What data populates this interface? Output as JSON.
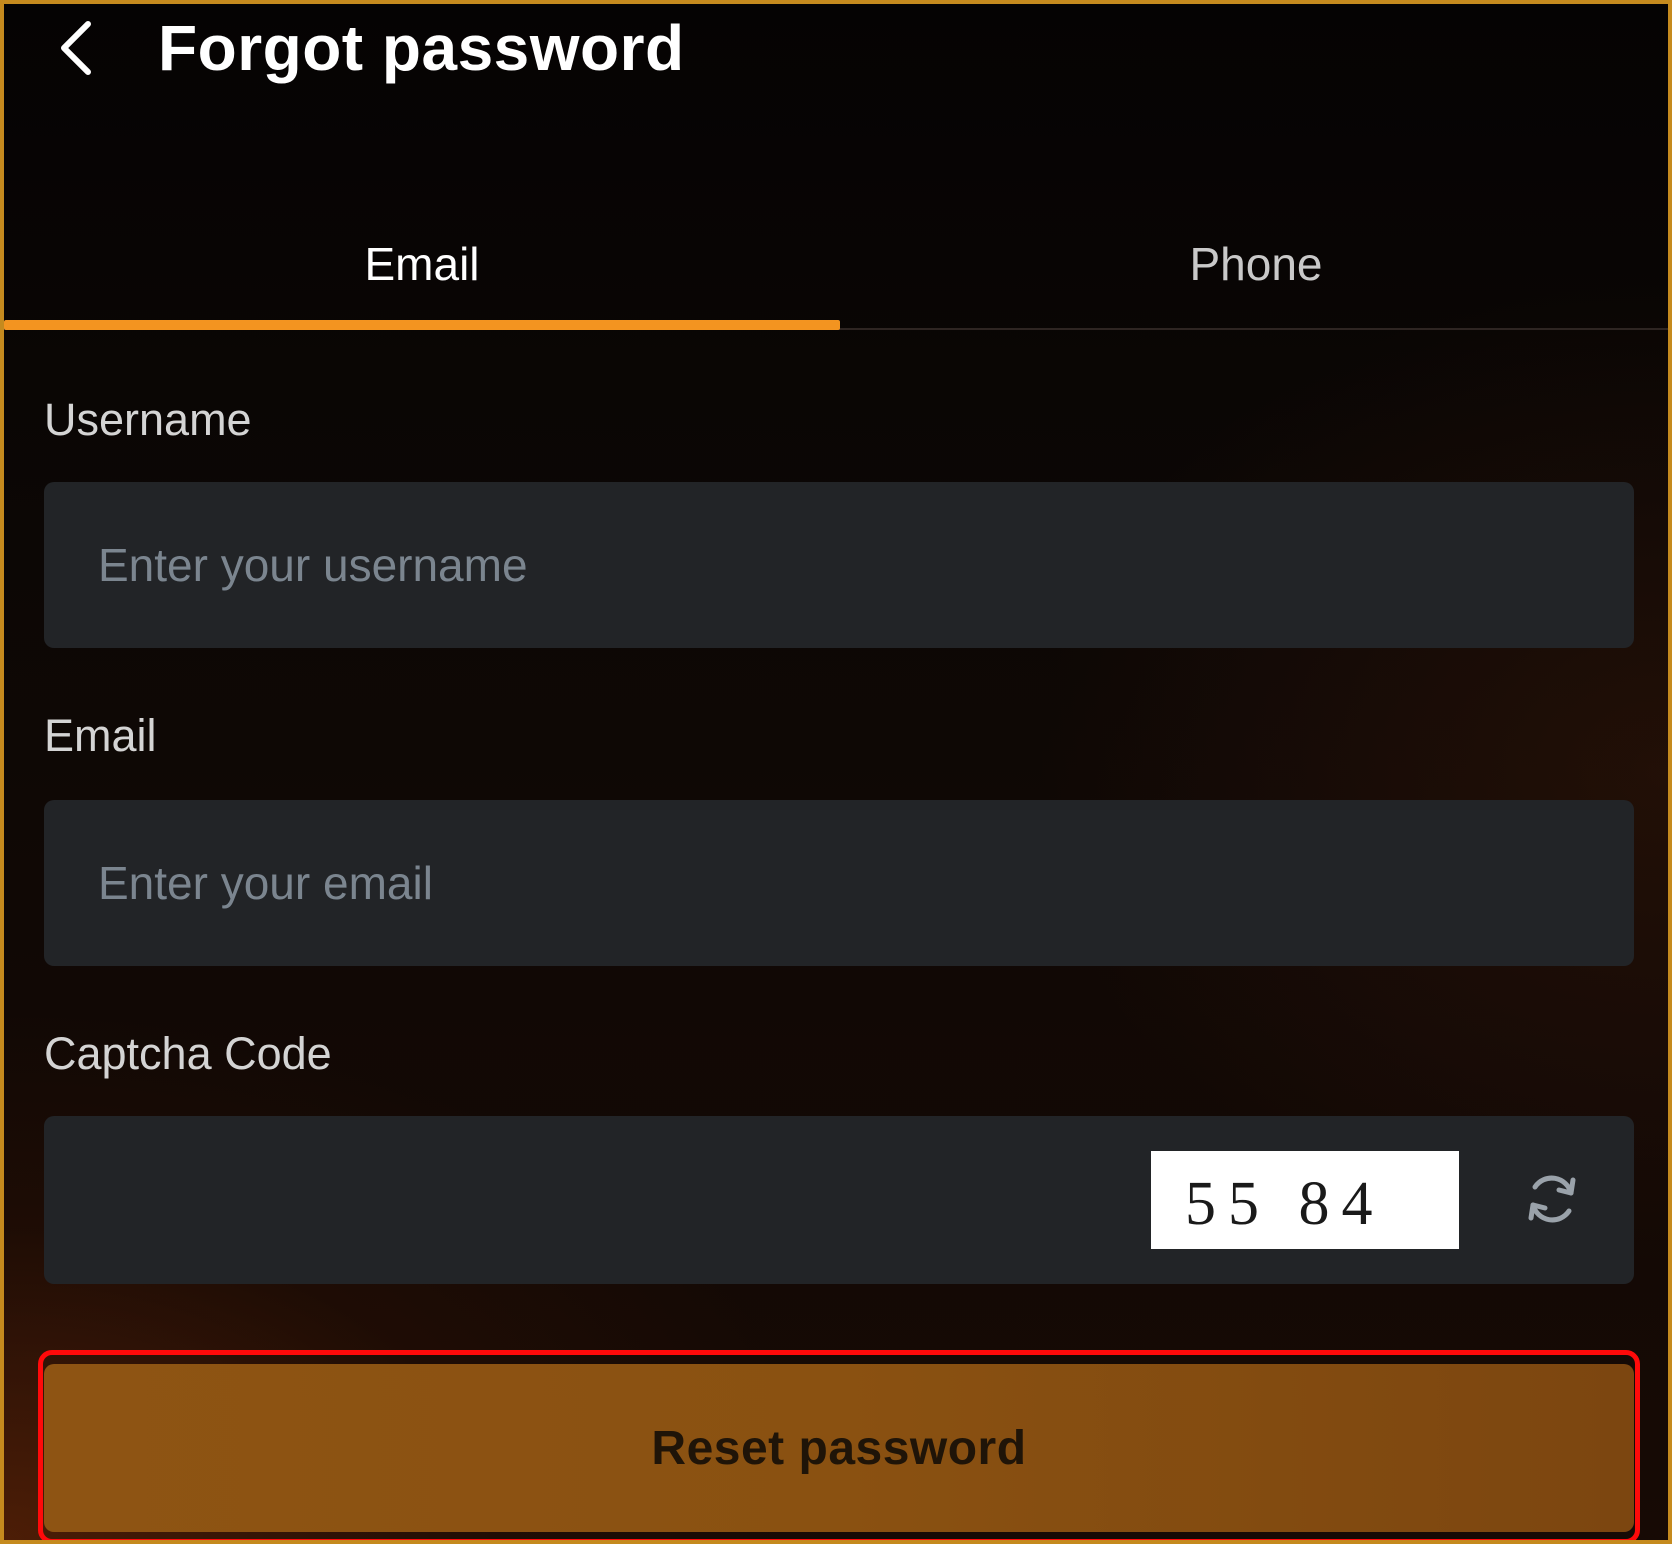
{
  "header": {
    "title": "Forgot password",
    "back_icon": "chevron-left-icon"
  },
  "tabs": [
    {
      "label": "Email",
      "active": true
    },
    {
      "label": "Phone",
      "active": false
    }
  ],
  "form": {
    "username": {
      "label": "Username",
      "placeholder": "Enter your username",
      "value": ""
    },
    "email": {
      "label": "Email",
      "placeholder": "Enter your email",
      "value": ""
    },
    "captcha": {
      "label": "Captcha Code",
      "value": "",
      "image_text": "55 84",
      "refresh_icon": "refresh-icon"
    }
  },
  "actions": {
    "reset_label": "Reset password"
  },
  "colors": {
    "accent": "#f39420",
    "button": "#8a5111",
    "input_bg": "#222427",
    "frame_border": "#c58a1e",
    "highlight": "#ff0a0a"
  }
}
